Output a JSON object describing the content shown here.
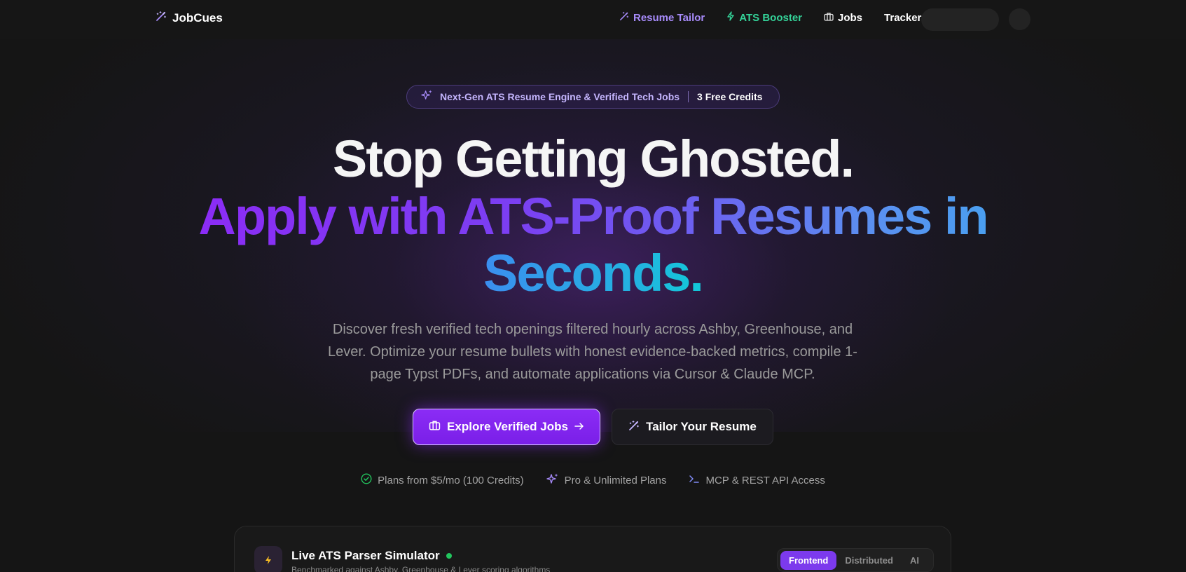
{
  "nav": {
    "brand": "JobCues",
    "links": [
      {
        "label": "Resume Tailor",
        "icon": "magic-wand-icon",
        "color": "#a78bfa"
      },
      {
        "label": "ATS Booster",
        "icon": "lightning-icon",
        "color": "#34d399"
      },
      {
        "label": "Jobs",
        "icon": "briefcase-icon",
        "color": "#ffffff"
      },
      {
        "label": "Tracker",
        "color": "#ffffff"
      }
    ]
  },
  "badge": {
    "icon": "sparkles-icon",
    "text": "Next-Gen ATS Resume Engine & Verified Tech Jobs",
    "credits": "3 Free Credits"
  },
  "hero": {
    "line1": "Stop Getting Ghosted.",
    "line2": "Apply with ATS-Proof Resumes in",
    "line3": "Seconds.",
    "subtext": "Discover fresh verified tech openings filtered hourly across Ashby, Greenhouse, and Lever. Optimize your resume bullets with honest evidence-backed metrics, compile 1-page Typst PDFs, and automate applications via Cursor & Claude MCP."
  },
  "cta": {
    "primary": {
      "label": "Explore Verified Jobs",
      "icon": "briefcase-icon",
      "trailing_icon": "arrow-right-icon"
    },
    "secondary": {
      "label": "Tailor Your Resume",
      "icon": "magic-wand-icon"
    }
  },
  "features": [
    {
      "label": "Plans from $5/mo (100 Credits)",
      "icon": "check-circle-icon"
    },
    {
      "label": "Pro & Unlimited Plans",
      "icon": "sparkles-icon"
    },
    {
      "label": "MCP & REST API Access",
      "icon": "terminal-icon"
    }
  ],
  "simulator": {
    "icon": "lightning-icon",
    "title": "Live ATS Parser Simulator",
    "subtitle": "Benchmarked against Ashby, Greenhouse & Lever scoring algorithms",
    "tabs": [
      "Frontend",
      "Distributed",
      "AI"
    ],
    "active_tab": "Frontend"
  },
  "colors": {
    "accent": "#8b2cf5",
    "success": "#22c55e",
    "background": "#151515"
  }
}
